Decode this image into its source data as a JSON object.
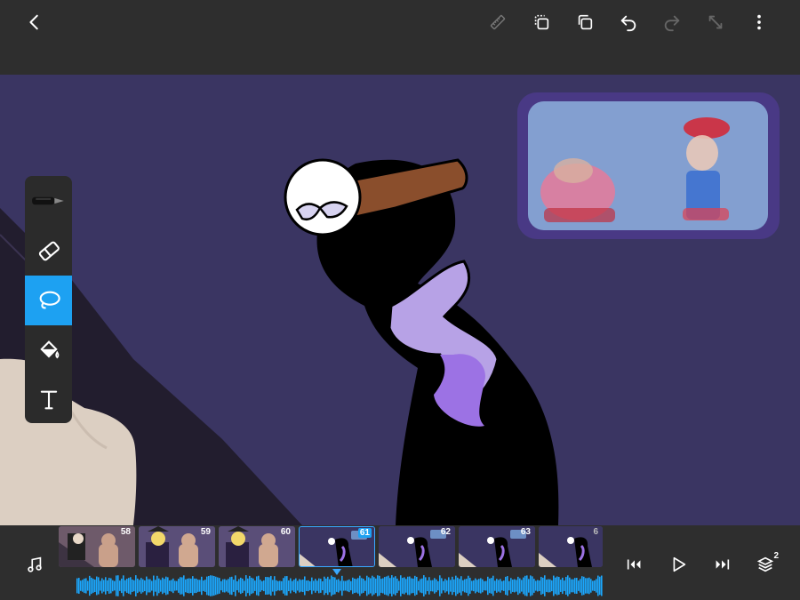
{
  "toolbar": {
    "back_icon": "chevron-left-icon",
    "actions": [
      "ruler-icon",
      "duplicate-icon",
      "copy-layer-icon",
      "undo-icon",
      "redo-icon",
      "transform-icon",
      "more-icon"
    ]
  },
  "tools": [
    "pen-icon",
    "eraser-icon",
    "lasso-icon",
    "fill-bucket-icon",
    "text-icon"
  ],
  "active_tool": "lasso",
  "timeline": {
    "frames": [
      {
        "number": "58"
      },
      {
        "number": "59"
      },
      {
        "number": "60"
      },
      {
        "number": "61"
      },
      {
        "number": "62"
      },
      {
        "number": "63"
      },
      {
        "number": "6"
      }
    ],
    "current_frame": "61",
    "layers_badge": "2"
  },
  "colors": {
    "accent": "#1da1f2",
    "background": "#3a3562",
    "bar": "#2e2e2e",
    "waveform": "#1aa8ff"
  }
}
